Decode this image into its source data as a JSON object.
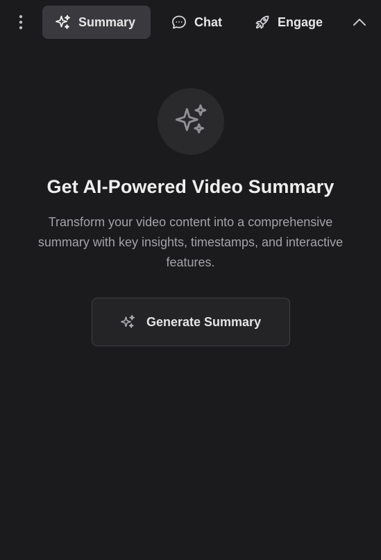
{
  "header": {
    "menu_icon": "more-vertical-icon",
    "tabs": [
      {
        "label": "Summary",
        "icon": "sparkles-icon",
        "active": true
      },
      {
        "label": "Chat",
        "icon": "message-circle-icon",
        "active": false
      },
      {
        "label": "Engage",
        "icon": "rocket-icon",
        "active": false
      }
    ],
    "collapse_icon": "chevron-up-icon"
  },
  "hero": {
    "icon": "sparkles-icon",
    "title": "Get AI-Powered Video Summary",
    "description": "Transform your video content into a comprehensive summary with key insights, timestamps, and interactive features.",
    "button_label": "Generate Summary",
    "button_icon": "sparkles-icon"
  },
  "colors": {
    "background": "#1b1b1d",
    "active_tab": "#3a3a3e",
    "hero_circle": "#2a2a2d",
    "button_bg": "#242427",
    "button_border": "#404045",
    "muted_text": "#a3a3a8"
  }
}
